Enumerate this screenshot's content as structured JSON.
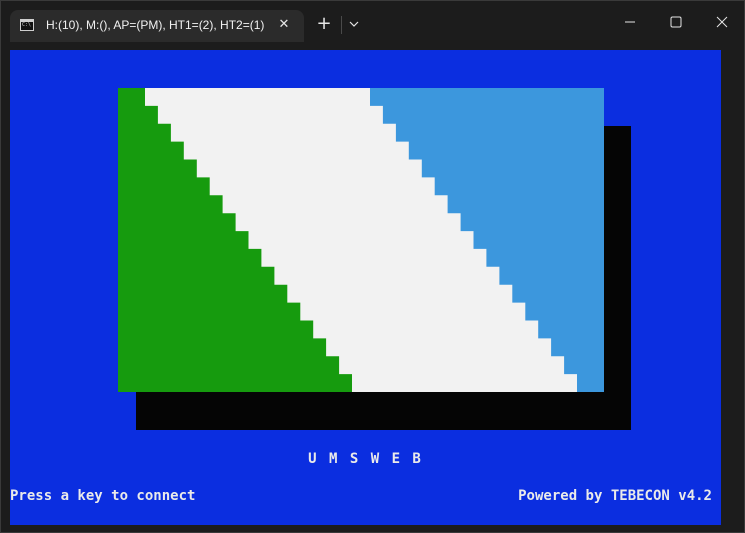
{
  "window": {
    "tab_title": "H:(10), M:(), AP=(PM), HT1=(2), HT2=(1)",
    "tab_close_glyph": "✕",
    "new_tab_glyph": "+",
    "dropdown_icon": "chevron-down-icon",
    "controls": [
      "minimize-icon",
      "maximize-icon",
      "close-icon"
    ]
  },
  "console": {
    "background_color": "#0b2ee0",
    "caption": "U M S W E B",
    "footer_left": "Press a key to connect",
    "footer_right": "Powered by TEBECON v4.2"
  },
  "flag": {
    "colors": {
      "green": "#169b0e",
      "white": "#f2f2f2",
      "blue": "#3c97dd",
      "shadow": "#050505"
    }
  }
}
